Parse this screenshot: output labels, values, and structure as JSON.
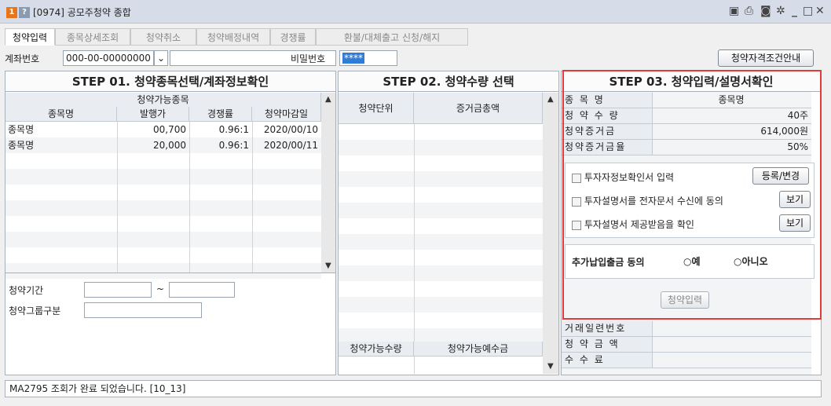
{
  "window": {
    "title": "[0974] 공모주청약 종합",
    "badge_num": "1",
    "badge_help": "?"
  },
  "tabs": [
    "청약입력",
    "종목상세조회",
    "청약취소",
    "청약배정내역",
    "경쟁률",
    "환불/대체출고 신청/해지"
  ],
  "account": {
    "label": "계좌번호",
    "value": "000-00-00000000",
    "password_label": "비밀번호",
    "password_value": "****",
    "guide_button": "청약자격조건안내"
  },
  "step1": {
    "title": "STEP 01. 청약종목선택/계좌정보확인",
    "group_header": "청약가능종목",
    "columns": [
      "종목명",
      "발행가",
      "경쟁률",
      "청약마감일"
    ],
    "rows": [
      {
        "name": "종목명",
        "price": "00,700",
        "rate": "0.96:1",
        "deadline": "2020/00/10"
      },
      {
        "name": "종목명",
        "price": "20,000",
        "rate": "0.96:1",
        "deadline": "2020/00/11"
      }
    ],
    "period_label": "청약기간",
    "period_sep": "~",
    "group_label": "청약그룹구분"
  },
  "step2": {
    "title": "STEP 02. 청약수량 선택",
    "columns": [
      "청약단위",
      "증거금총액"
    ],
    "footer_columns": [
      "청약가능수량",
      "청약가능예수금"
    ]
  },
  "step3": {
    "title": "STEP 03. 청약입력/설명서확인",
    "fields": [
      {
        "label": "종 목 명",
        "value": "종목명"
      },
      {
        "label": "청 약 수 량",
        "value": "40주"
      },
      {
        "label": "청약증거금",
        "value": "614,000원"
      },
      {
        "label": "청약증거금율",
        "value": "50%"
      }
    ],
    "checks": [
      {
        "label": "투자자정보확인서 입력",
        "button": "등록/변경"
      },
      {
        "label": "투자설명서를 전자문서 수신에 동의",
        "button": "보기"
      },
      {
        "label": "투자설명서 제공받음을 확인",
        "button": "보기"
      }
    ],
    "extra": {
      "label": "추가납입출금 동의",
      "yes": "예",
      "no": "아니오"
    },
    "submit": "청약입력",
    "bottom_fields": [
      {
        "label": "거래일련번호",
        "value": ""
      },
      {
        "label": "청 약 금 액",
        "value": ""
      },
      {
        "label": "수 수 료",
        "value": ""
      }
    ]
  },
  "status": "MA2795 조회가 완료 되었습니다. [10_13]"
}
